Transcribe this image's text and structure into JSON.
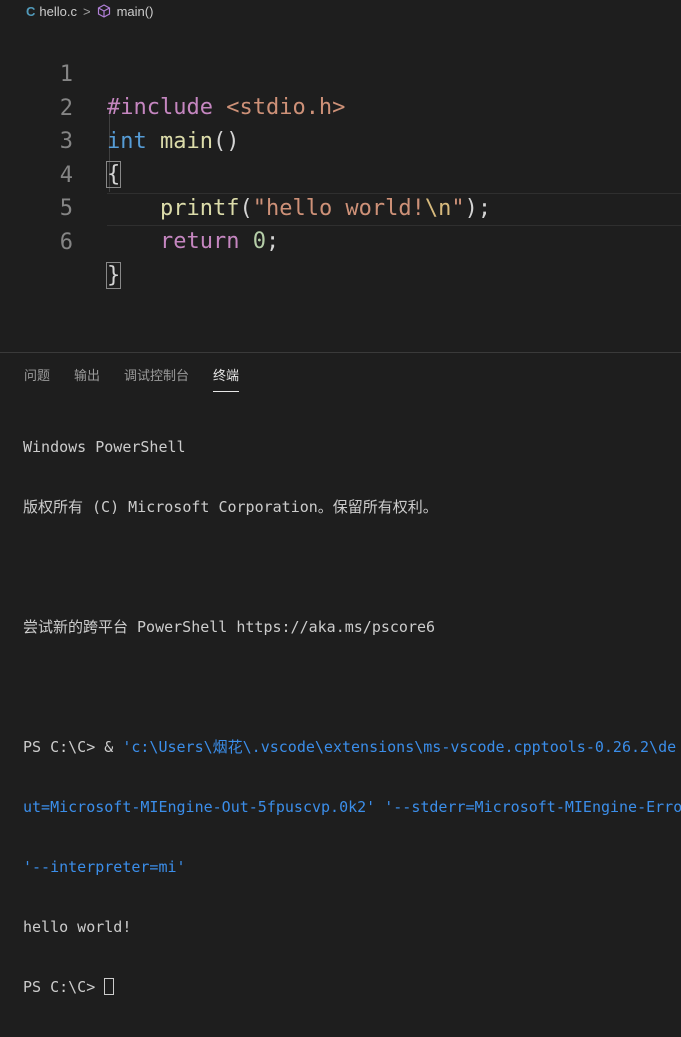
{
  "breadcrumb": {
    "file_icon": "C",
    "file_name": "hello.c",
    "separator": ">",
    "symbol_icon": "cube-icon",
    "symbol_name": "main()"
  },
  "editor": {
    "line_numbers": [
      "1",
      "2",
      "3",
      "4",
      "5",
      "6"
    ],
    "line1": {
      "directive": "#include",
      "header": "<stdio.h>"
    },
    "line2": {
      "type": "int",
      "name": "main",
      "parens": "()"
    },
    "line3": {
      "brace": "{"
    },
    "line4": {
      "func": "printf",
      "open": "(",
      "string": "\"hello world!",
      "escape": "\\n",
      "string_end": "\"",
      "close": ");"
    },
    "line5": {
      "keyword": "return",
      "value": "0",
      "semi": ";"
    },
    "line6": {
      "brace": "}"
    }
  },
  "panel": {
    "tabs": [
      "问题",
      "输出",
      "调试控制台",
      "终端"
    ],
    "active_tab": "终端",
    "terminal": {
      "lines": [
        "Windows PowerShell",
        "版权所有 (C) Microsoft Corporation。保留所有权利。",
        "",
        "尝试新的跨平台 PowerShell https://aka.ms/pscore6",
        ""
      ],
      "cmd_prompt": "PS C:\\C> & ",
      "cmd_path": "'c:\\Users\\烟花\\.vscode\\extensions\\ms-vscode.cpptools-0.26.2\\de",
      "cmd_line2": "ut=Microsoft-MIEngine-Out-5fpuscvp.0k2' '--stderr=Microsoft-MIEngine-Erro",
      "cmd_line3": "'--interpreter=mi'",
      "output": "hello world!",
      "final_prompt": "PS C:\\C> "
    }
  },
  "colors": {
    "background": "#1e1e1e",
    "keyword": "#569cd6",
    "directive": "#c586c0",
    "string": "#ce9178",
    "function": "#dcdcaa",
    "number": "#b5cea8",
    "link": "#3b8eea"
  }
}
